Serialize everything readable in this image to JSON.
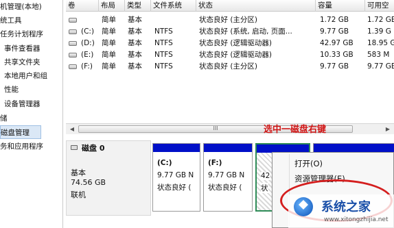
{
  "nav": {
    "items": [
      "机管理(本地)",
      "统工具",
      "任务计划程序",
      "事件查看器",
      "共享文件夹",
      "本地用户和组",
      "性能",
      "设备管理器",
      "储",
      "磁盘管理",
      "务和应用程序"
    ],
    "selected_index": 9
  },
  "volume_table": {
    "headers": [
      "卷",
      "布局",
      "类型",
      "文件系统",
      "状态",
      "容量",
      "可用空"
    ],
    "rows": [
      {
        "vol": "",
        "layout": "简单",
        "type": "基本",
        "fs": "",
        "status": "状态良好 (主分区)",
        "capacity": "1.72 GB",
        "free": "1.72 GB"
      },
      {
        "vol": "(C:)",
        "layout": "简单",
        "type": "基本",
        "fs": "NTFS",
        "status": "状态良好 (系统, 启动, 页面...",
        "capacity": "9.77 GB",
        "free": "1.39 G"
      },
      {
        "vol": "(D:)",
        "layout": "简单",
        "type": "基本",
        "fs": "NTFS",
        "status": "状态良好 (逻辑驱动器)",
        "capacity": "42.97 GB",
        "free": "18.95 G"
      },
      {
        "vol": "(E:)",
        "layout": "简单",
        "type": "基本",
        "fs": "NTFS",
        "status": "状态良好 (逻辑驱动器)",
        "capacity": "10.33 GB",
        "free": "583 M"
      },
      {
        "vol": "(F:)",
        "layout": "简单",
        "type": "基本",
        "fs": "NTFS",
        "status": "状态良好 (主分区)",
        "capacity": "9.77 GB",
        "free": "9.77 GB"
      }
    ]
  },
  "scrollbar": {
    "grip": "III"
  },
  "annotation": "选中一磁盘右键",
  "disk": {
    "name": "磁盘 0",
    "type": "基本",
    "size": "74.56 GB",
    "status": "联机"
  },
  "partitions": [
    {
      "name": "(C:)",
      "size": "9.77 GB N",
      "status": "状态良好 ("
    },
    {
      "name": "(F:)",
      "size": "9.77 GB N",
      "status": "状态良好 ("
    },
    {
      "name": "",
      "size": "42",
      "status": "状"
    }
  ],
  "context_menu": {
    "items": [
      "打开(O)",
      "资源管理器(E)"
    ]
  },
  "watermark": {
    "name": "系统之家",
    "site": "www.xitongzhijia.net"
  },
  "colors": {
    "partition_bar": "#0010c8",
    "annotation": "#d01515",
    "selection": "#dbe8f6"
  }
}
